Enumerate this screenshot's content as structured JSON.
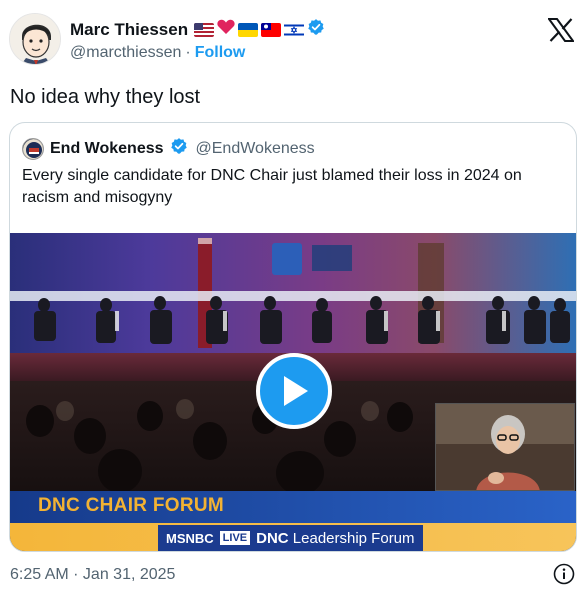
{
  "author": {
    "display_name": "Marc Thiessen",
    "handle": "@marcthiessen",
    "separator": "·",
    "follow_label": "Follow",
    "badges": [
      "us-flag-icon",
      "red-heart-icon",
      "ukraine-flag-icon",
      "taiwan-flag-icon",
      "israel-flag-icon",
      "verified-badge-icon"
    ]
  },
  "tweet": {
    "text": "No idea why they lost",
    "timestamp": "6:25 AM · Jan 31, 2025"
  },
  "quote": {
    "display_name": "End Wokeness",
    "handle": "@EndWokeness",
    "text": "Every single candidate for DNC Chair just blamed their loss in 2024 on racism and misogyny",
    "video": {
      "banner_title": "DNC CHAIR FORUM",
      "network": "MSNBC",
      "live_label": "LIVE",
      "ticker_bold": "DNC",
      "ticker_rest": " Leadership Forum",
      "play_icon": "play-icon"
    }
  },
  "colors": {
    "accent": "#1d9bf0",
    "text": "#0f1419",
    "muted": "#536471",
    "border": "#cfd9de",
    "banner_gold": "#f2b233"
  }
}
